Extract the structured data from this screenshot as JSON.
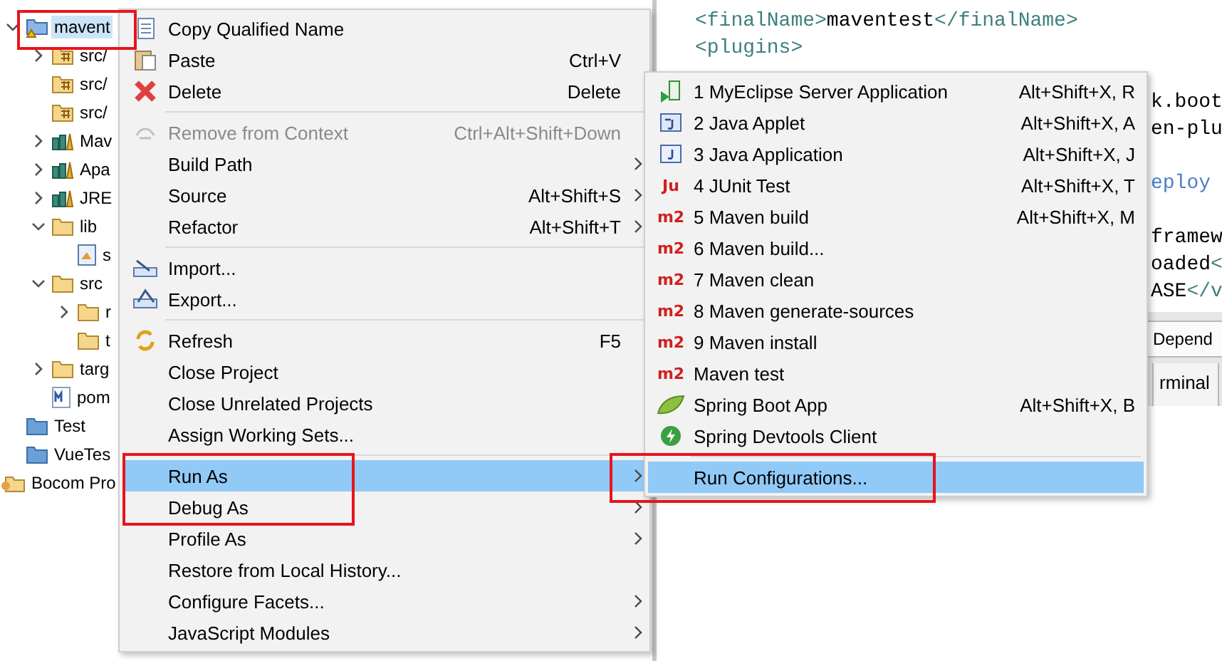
{
  "tree": [
    {
      "label": "mavent",
      "kind": "maven-project",
      "expanded": true,
      "selected": true,
      "children": [
        {
          "label": "src/",
          "kind": "package-folder",
          "expanded": false
        },
        {
          "label": "src/",
          "kind": "package-folder"
        },
        {
          "label": "src/",
          "kind": "package-folder"
        },
        {
          "label": "Mav",
          "kind": "library",
          "expanded": false
        },
        {
          "label": "Apa",
          "kind": "library",
          "expanded": false
        },
        {
          "label": "JRE",
          "kind": "library",
          "expanded": false
        },
        {
          "label": "lib",
          "kind": "folder",
          "expanded": true,
          "children": [
            {
              "label": "s",
              "kind": "file"
            }
          ]
        },
        {
          "label": "src",
          "kind": "folder",
          "expanded": true,
          "children": [
            {
              "label": "r",
              "kind": "folder",
              "expanded": false
            },
            {
              "label": "t",
              "kind": "folder"
            }
          ]
        },
        {
          "label": "targ",
          "kind": "folder",
          "expanded": false
        },
        {
          "label": "pom",
          "kind": "pom"
        }
      ]
    },
    {
      "label": "Test",
      "kind": "project"
    },
    {
      "label": "VueTes",
      "kind": "project"
    },
    {
      "label": "Bocom Pro",
      "kind": "working-set"
    }
  ],
  "editor": {
    "lines": [
      {
        "kind": "shown",
        "segments": [
          {
            "kind": "tag",
            "text": "<finalName>"
          },
          {
            "kind": "text",
            "text": "maventest"
          },
          {
            "kind": "tag",
            "text": "</finalName>"
          }
        ]
      },
      {
        "kind": "shown",
        "segments": [
          {
            "kind": "tag",
            "text": "<plugins>"
          }
        ]
      },
      {
        "kind": "blank"
      },
      {
        "kind": "partial",
        "segments": [
          {
            "kind": "text",
            "text": "k.boot"
          }
        ]
      },
      {
        "kind": "partial",
        "segments": [
          {
            "kind": "text",
            "text": "en-plu"
          }
        ]
      },
      {
        "kind": "blank"
      },
      {
        "kind": "partial",
        "segments": [
          {
            "kind": "comment",
            "text": "eploy"
          }
        ]
      },
      {
        "kind": "blank"
      },
      {
        "kind": "partial",
        "segments": [
          {
            "kind": "text",
            "text": "framew"
          }
        ]
      },
      {
        "kind": "partial",
        "segments": [
          {
            "kind": "text",
            "text": "oaded"
          },
          {
            "kind": "tag",
            "text": "<"
          }
        ]
      },
      {
        "kind": "partial",
        "segments": [
          {
            "kind": "text",
            "text": "ASE"
          },
          {
            "kind": "tag",
            "text": "</v"
          }
        ]
      }
    ],
    "tabs": [
      {
        "label": "Depend"
      },
      {
        "label": "rminal"
      }
    ]
  },
  "context_menu": {
    "sections": [
      [
        {
          "label": "Copy Qualified Name",
          "kind": "copy"
        },
        {
          "label": "Paste",
          "shortcut": "Ctrl+V",
          "kind": "paste"
        },
        {
          "label": "Delete",
          "shortcut": "Delete",
          "kind": "delete"
        }
      ],
      [
        {
          "label": "Remove from Context",
          "shortcut": "Ctrl+Alt+Shift+Down",
          "kind": "remove",
          "disabled": true
        },
        {
          "label": "Build Path",
          "submenu": true
        },
        {
          "label": "Source",
          "shortcut": "Alt+Shift+S",
          "submenu": true
        },
        {
          "label": "Refactor",
          "shortcut": "Alt+Shift+T",
          "submenu": true
        }
      ],
      [
        {
          "label": "Import...",
          "kind": "import"
        },
        {
          "label": "Export...",
          "kind": "export"
        }
      ],
      [
        {
          "label": "Refresh",
          "shortcut": "F5",
          "kind": "refresh"
        },
        {
          "label": "Close Project"
        },
        {
          "label": "Close Unrelated Projects"
        },
        {
          "label": "Assign Working Sets..."
        }
      ],
      [
        {
          "label": "Run As",
          "submenu": true,
          "selected": true
        },
        {
          "label": "Debug As",
          "submenu": true,
          "selected": false
        },
        {
          "label": "Profile As",
          "submenu": true,
          "selected": false
        },
        {
          "label": "Restore from Local History..."
        },
        {
          "label": "Configure Facets...",
          "submenu": true
        },
        {
          "label": "JavaScript Modules",
          "submenu": true
        }
      ]
    ]
  },
  "run_as_menu": {
    "sections": [
      [
        {
          "label": "1 MyEclipse Server Application",
          "shortcut": "Alt+Shift+X, R",
          "kind": "server"
        },
        {
          "label": "2 Java Applet",
          "shortcut": "Alt+Shift+X, A",
          "kind": "applet"
        },
        {
          "label": "3 Java Application",
          "shortcut": "Alt+Shift+X, J",
          "kind": "application"
        },
        {
          "label": "4 JUnit Test",
          "shortcut": "Alt+Shift+X, T",
          "kind": "badge",
          "badge": "Ju"
        },
        {
          "label": "5 Maven build",
          "shortcut": "Alt+Shift+X, M",
          "kind": "badge",
          "badge": "m2"
        },
        {
          "label": "6 Maven build...",
          "kind": "badge",
          "badge": "m2"
        },
        {
          "label": "7 Maven clean",
          "kind": "badge",
          "badge": "m2"
        },
        {
          "label": "8 Maven generate-sources",
          "kind": "badge",
          "badge": "m2"
        },
        {
          "label": "9 Maven install",
          "kind": "badge",
          "badge": "m2"
        },
        {
          "label": "Maven test",
          "kind": "badge",
          "badge": "m2"
        },
        {
          "label": "Spring Boot App",
          "shortcut": "Alt+Shift+X, B",
          "kind": "leaf"
        },
        {
          "label": "Spring Devtools Client",
          "kind": "devtools"
        }
      ],
      [
        {
          "label": "Run Configurations...",
          "selected": true
        }
      ]
    ]
  }
}
